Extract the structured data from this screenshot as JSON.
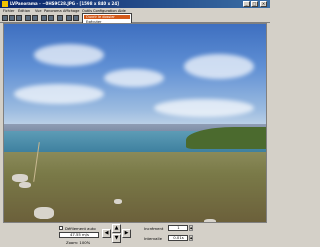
{
  "window": {
    "title": "LVPanorama - ~0HS9C28.JPG - [1598 x 840 x 24]"
  },
  "menu": [
    "Fichier",
    "Édition",
    "Vue",
    "Panorama",
    "Affichage",
    "Outils",
    "Configuration",
    "Aide"
  ],
  "dropdown": {
    "item1": "Ouvrir le dossier",
    "item2": "Exécuter"
  },
  "controls": {
    "auto_scroll_label": "Défilement auto",
    "speed_value": "47.55 m/s",
    "zoom_label": "Zoom: 100%",
    "increment_label": "Incrément",
    "increment_value": "1",
    "interval_label": "Intervalle",
    "interval_value": "0.01s"
  }
}
